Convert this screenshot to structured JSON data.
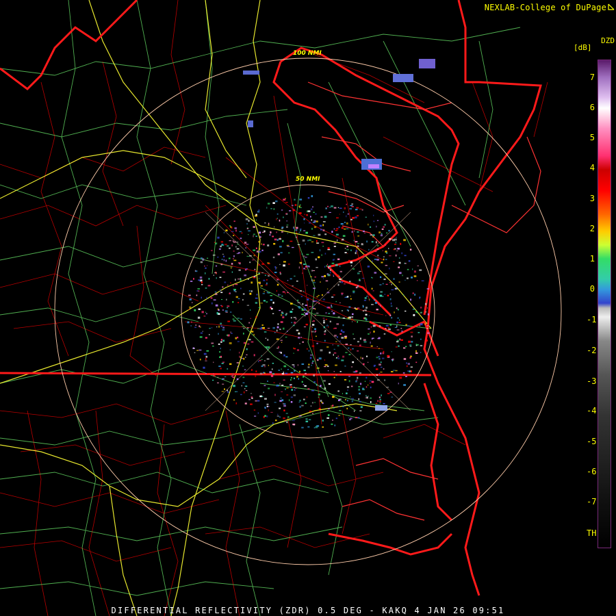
{
  "header": {
    "credit": "NEXLAB-College of DuPage",
    "product_code": "DZD",
    "units": "[dB]"
  },
  "range_rings": [
    {
      "label": "100 NMI"
    },
    {
      "label": "50 NMI"
    }
  ],
  "legend": {
    "ticks": [
      "7",
      "6",
      "5",
      "4",
      "3",
      "2",
      "1",
      "0",
      "-1",
      "-2",
      "-3",
      "-4",
      "-5",
      "-6",
      "-7",
      "TH"
    ]
  },
  "footer": {
    "title": "DIFFERENTIAL REFLECTIVITY (ZDR) 0.5 DEG - KAKQ 4 JAN 26 09:51"
  },
  "colors": {
    "background": "#000000",
    "state_borders": "#ff1a1a",
    "county_lines": "#cc0000",
    "highways": "#ffff33",
    "roads": "#66dd66",
    "range_rings": "#ffccaa",
    "label_text": "#ffff00"
  }
}
